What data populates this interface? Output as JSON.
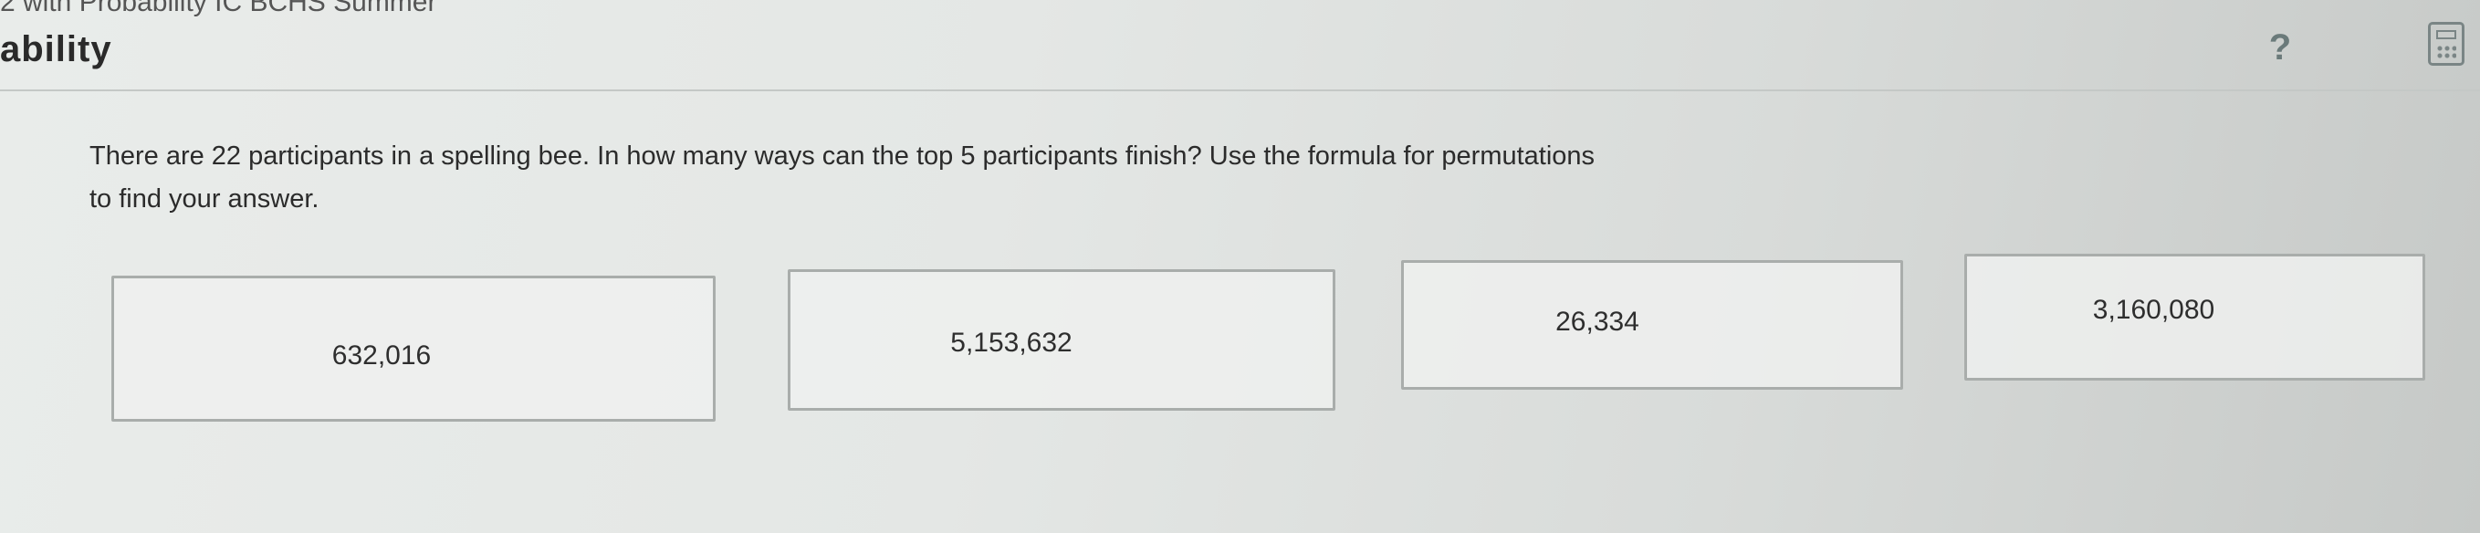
{
  "header": {
    "breadcrumb": "2 with Probability IC BCHS Summer",
    "title": "ability",
    "help_icon": "question-mark-icon",
    "calculator_icon": "calculator-icon"
  },
  "question": {
    "text": "There are 22 participants in a spelling bee. In how many ways can the top 5 participants finish? Use the formula for permutations to find your answer."
  },
  "choices": [
    {
      "label": "632,016"
    },
    {
      "label": "5,153,632"
    },
    {
      "label": "26,334"
    },
    {
      "label": "3,160,080"
    }
  ]
}
